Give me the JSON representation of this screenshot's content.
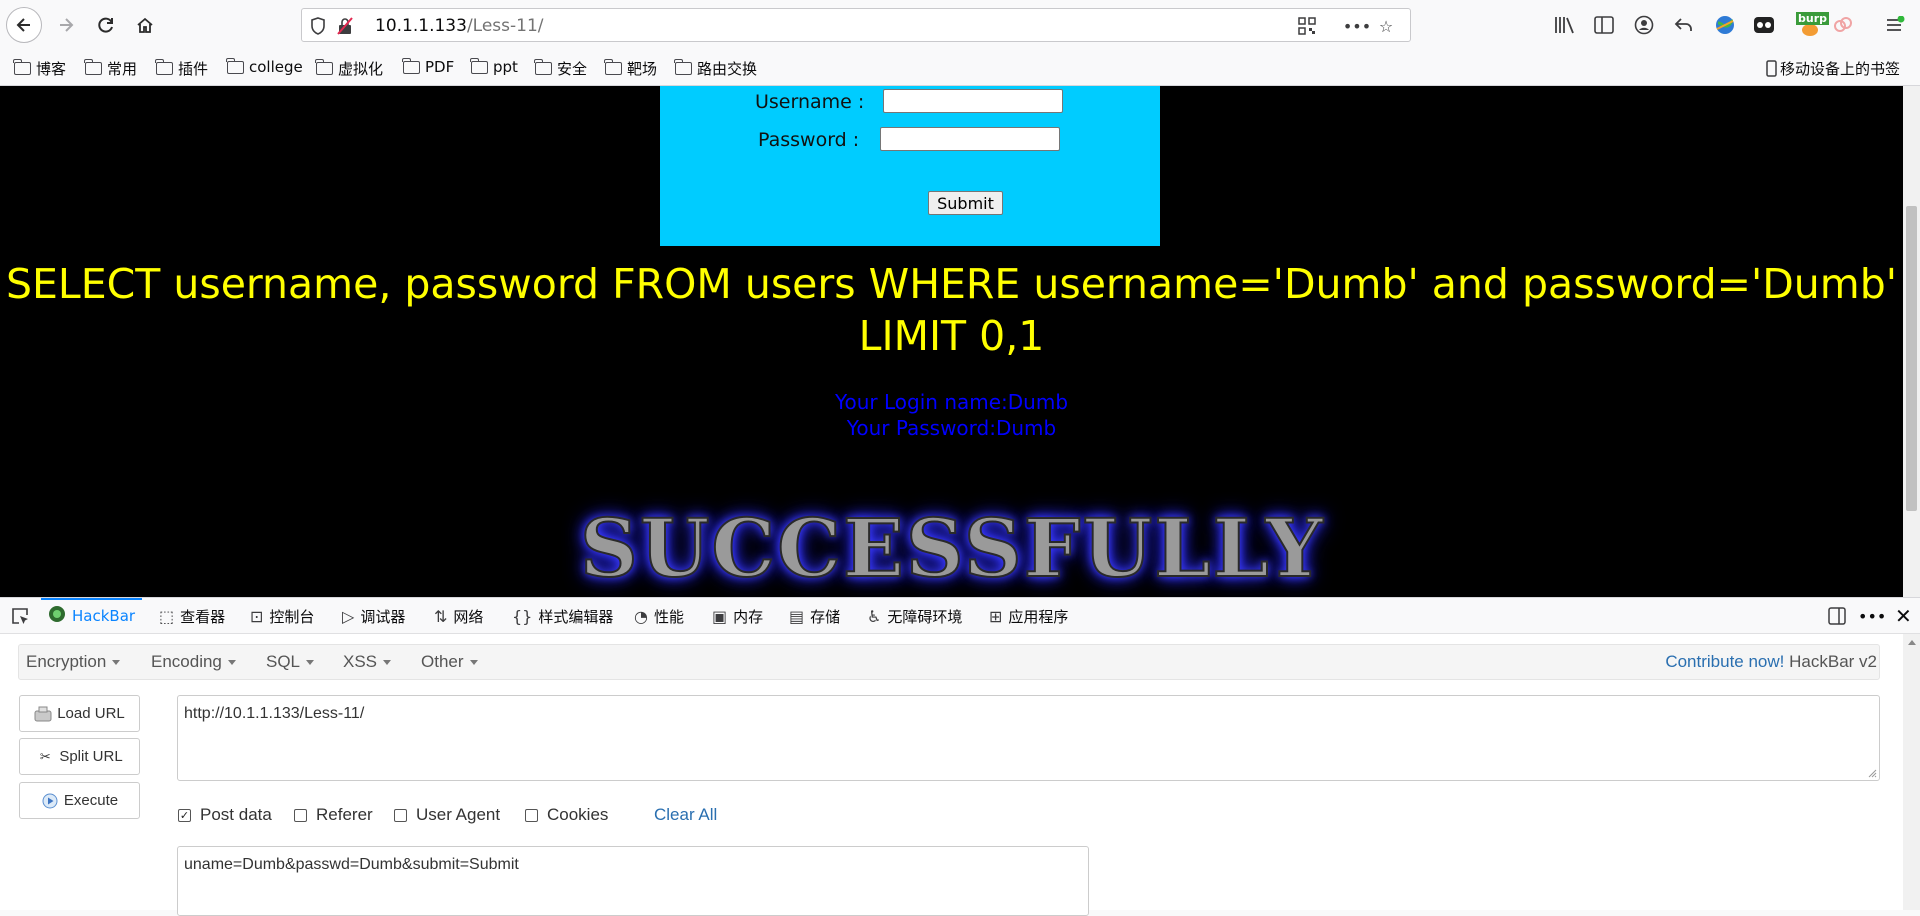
{
  "browser": {
    "url_host": "10.1.1.133",
    "url_path": "/Less-11/",
    "bookmarks": [
      "博客",
      "常用",
      "插件",
      "college",
      "虚拟化",
      "PDF",
      "ppt",
      "安全",
      "靶场",
      "路由交换"
    ],
    "mobile_bookmarks": "移动设备上的书签",
    "burp_label": "burp"
  },
  "page": {
    "username_label": "Username :",
    "password_label": "Password :",
    "submit_label": "Submit",
    "sql_query": "SELECT username, password FROM users WHERE username='Dumb' and password='Dumb' LIMIT 0,1",
    "login_name": "Your Login name:Dumb",
    "login_password": "Your Password:Dumb",
    "banner_text": "SUCCESSFULLY"
  },
  "devtools": {
    "tabs": [
      "HackBar",
      "查看器",
      "控制台",
      "调试器",
      "网络",
      "样式编辑器",
      "性能",
      "内存",
      "存储",
      "无障碍环境",
      "应用程序"
    ],
    "active_tab": "HackBar"
  },
  "hackbar": {
    "menus": [
      "Encryption",
      "Encoding",
      "SQL",
      "XSS",
      "Other"
    ],
    "contribute_link": "Contribute now!",
    "version": "HackBar v2",
    "load_url": "Load URL",
    "split_url": "Split URL",
    "execute": "Execute",
    "url_value": "http://10.1.1.133/Less-11/",
    "checkboxes": [
      {
        "label": "Post data",
        "checked": true
      },
      {
        "label": "Referer",
        "checked": false
      },
      {
        "label": "User Agent",
        "checked": false
      },
      {
        "label": "Cookies",
        "checked": false
      }
    ],
    "clear_all": "Clear All",
    "post_value": "uname=Dumb&passwd=Dumb&submit=Submit"
  }
}
